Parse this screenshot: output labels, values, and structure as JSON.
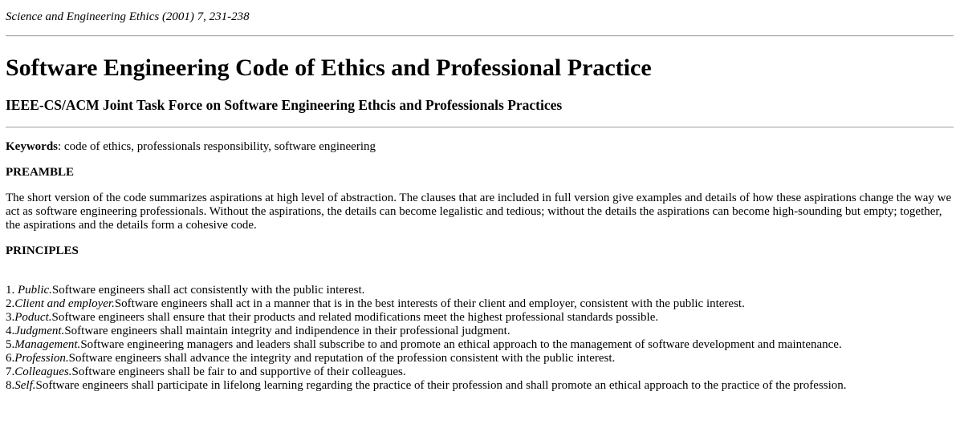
{
  "header": {
    "citation": "Science and Engineering Ethics (2001) 7, 231-238"
  },
  "title": "Software Engineering Code of Ethics and Professional Practice",
  "subtitle": "IEEE-CS/ACM Joint Task Force on Software Engineering Ethcis and Professionals Practices",
  "keywords": {
    "label": "Keywords",
    "text": ": code of ethics, professionals responsibility, software engineering"
  },
  "preamble": {
    "heading": "PREAMBLE",
    "text": "The short version of the code summarizes aspirations at high level of abstraction. The clauses that are included in full version give examples and details of how these aspirations change the way we act as software engineering professionals. Without the aspirations, the details can become legalistic and tedious; without the details the aspirations can become high-sounding but empty; together, the aspirations and the details form a cohesive code."
  },
  "principles": {
    "heading": "PRINCIPLES",
    "items": [
      {
        "number": "1. ",
        "title": "Public.",
        "text": "Software engineers shall act consistently with the public interest."
      },
      {
        "number": "2.",
        "title": "Client and employer.",
        "text": "Software engineers shall act in a manner that is in the best interests of their client and employer, consistent with the public interest."
      },
      {
        "number": "3.",
        "title": "Poduct.",
        "text": "Software engineers shall ensure that their products and related modifications meet the highest professional standards possible."
      },
      {
        "number": "4.",
        "title": "Judgment.",
        "text": "Software engineers shall maintain integrity and indipendence in their professional judgment."
      },
      {
        "number": "5.",
        "title": "Management.",
        "text": "Software engineering managers and leaders shall subscribe to and promote an ethical approach to the management of software development and maintenance."
      },
      {
        "number": "6.",
        "title": "Profession.",
        "text": "Software engineers shall advance the integrity and reputation of the profession consistent with the public interest."
      },
      {
        "number": "7.",
        "title": "Colleagues.",
        "text": "Software engineers shall be fair to and supportive of their colleagues."
      },
      {
        "number": "8.",
        "title": "Self.",
        "text": "Software engineers shall participate in lifelong learning regarding the practice of their profession and shall promote an ethical approach to the practice of the profession."
      }
    ]
  }
}
